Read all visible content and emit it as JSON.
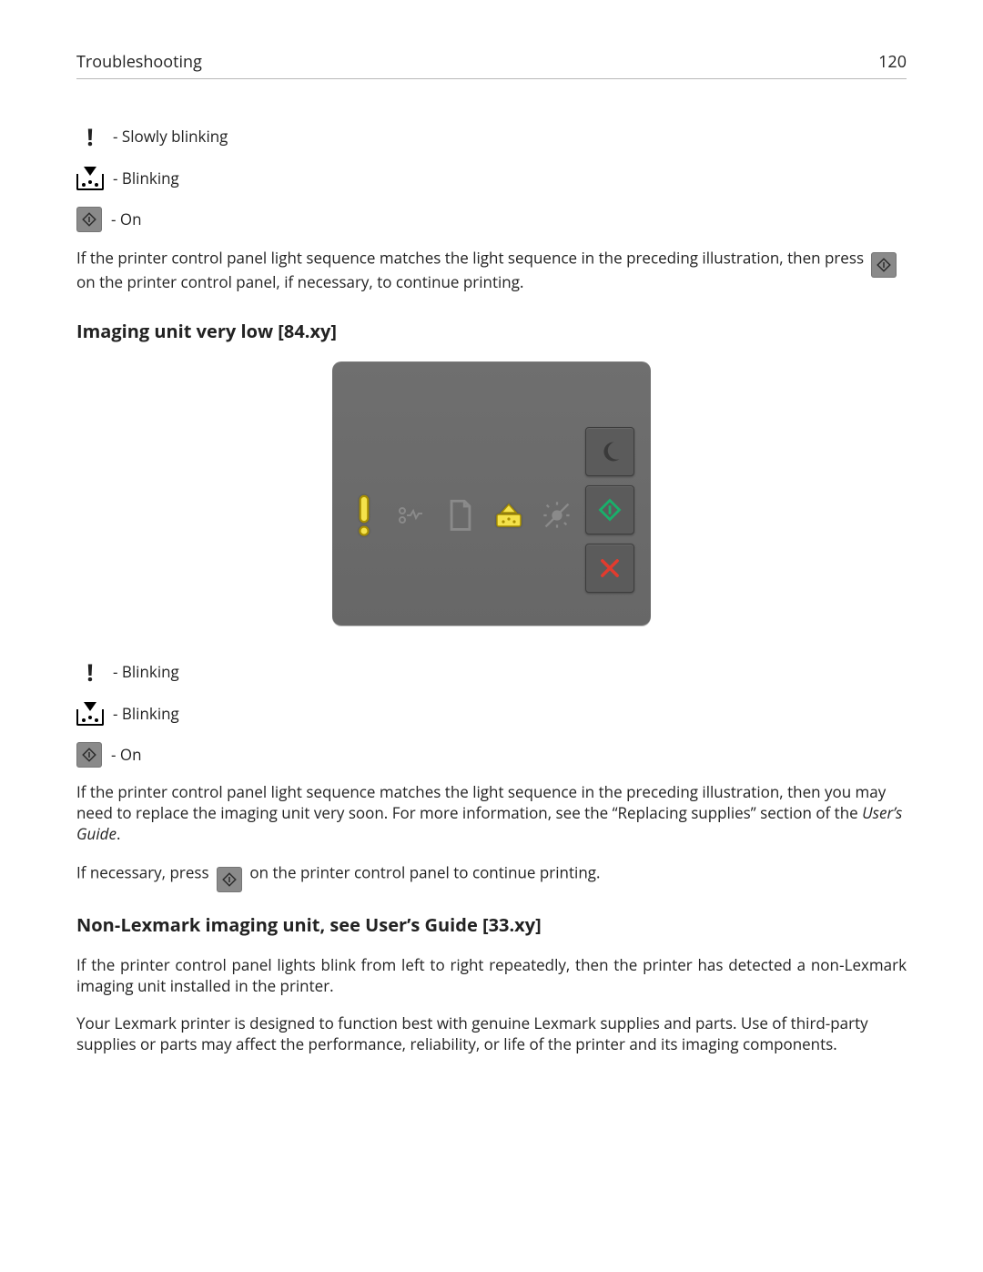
{
  "header": {
    "section_title": "Troubleshooting",
    "page_number": "120"
  },
  "legend_top": {
    "exclaim": "Slowly blinking",
    "toner": "Blinking",
    "start": "On"
  },
  "para_after_legend_top": {
    "before_icon": "If the printer control panel light sequence matches the light sequence in the preceding illustration, then press ",
    "after_icon": " on the printer control panel, if necessary, to continue printing."
  },
  "section_imaging": {
    "heading": "Imaging unit very low [84.xy]"
  },
  "legend_bottom": {
    "exclaim": "Blinking",
    "toner": "Blinking",
    "start": "On"
  },
  "para_after_legend_bottom": {
    "text_before_guide": "If the printer control panel light sequence matches the light sequence in the preceding illustration, then you may need to replace the imaging unit very soon. For more information, see the “Replacing supplies” section of the ",
    "guide": "User’s Guide",
    "text_after_guide": "."
  },
  "para_if_necessary": {
    "before_icon": "If necessary, press ",
    "after_icon": " on the printer control panel to continue printing."
  },
  "section_non_lexmark": {
    "heading": "Non‑Lexmark imaging unit, see User’s Guide [33.xy]",
    "para1": "If the printer control panel lights blink from left to right repeatedly, then the printer has detected a non‑Lexmark imaging unit installed in the printer.",
    "para2": "Your Lexmark printer is designed to function best with genuine Lexmark supplies and parts. Use of third-party supplies or parts may affect the performance, reliability, or life of the printer and its imaging components."
  },
  "icons": {
    "start_button_name": "start-button-icon",
    "sleep": "sleep-icon",
    "cancel": "cancel-icon",
    "exclaim": "warning-exclaim-icon",
    "jam": "paper-jam-icon",
    "page": "load-paper-icon",
    "toner": "toner-ink-icon",
    "lamp": "error-lamp-icon"
  },
  "colors": {
    "panel_bg": "#6b6b6b",
    "btn_bg": "#5b5b5b",
    "start_green": "#18b06a",
    "cancel_red": "#e33b2e",
    "highlight_yellow": "#f4e24b",
    "highlight_stroke": "#a88f00",
    "muted_icon": "#8a8a8a"
  }
}
